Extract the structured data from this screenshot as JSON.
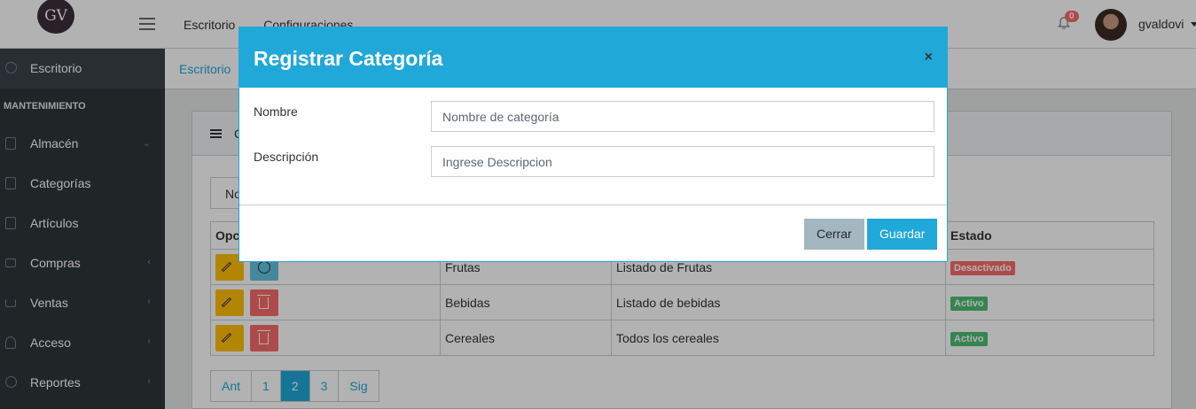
{
  "header": {
    "logo_text": "GV",
    "nav": [
      "Escritorio",
      "Configuraciones"
    ],
    "notification_count": "0",
    "username": "gvaldovi"
  },
  "sidebar": {
    "section_title": "MANTENIMIENTO",
    "items": [
      {
        "label": "Escritorio",
        "icon": "speedometer-icon",
        "chevron": false
      },
      {
        "label": "Almacén",
        "icon": "bag-icon",
        "chevron": true
      },
      {
        "label": "Categorías",
        "icon": "bag-icon",
        "chevron": false
      },
      {
        "label": "Artículos",
        "icon": "bag-icon",
        "chevron": false
      },
      {
        "label": "Compras",
        "icon": "wallet-icon",
        "chevron": true
      },
      {
        "label": "Ventas",
        "icon": "basket-icon",
        "chevron": true
      },
      {
        "label": "Acceso",
        "icon": "people-icon",
        "chevron": true
      },
      {
        "label": "Reportes",
        "icon": "pie-chart-icon",
        "chevron": true
      }
    ]
  },
  "breadcrumb": {
    "current": "Escritorio"
  },
  "card": {
    "header_text": "C",
    "search_stub": "No"
  },
  "table": {
    "headers": {
      "options": "Opc",
      "estado": "Estado"
    },
    "rows": [
      {
        "nombre": "Frutas",
        "descripcion": "Listado de Frutas",
        "estado": "Desactivado",
        "estado_color": "#f86c6b"
      },
      {
        "nombre": "Bebidas",
        "descripcion": "Listado de bebidas",
        "estado": "Activo",
        "estado_color": "#4dbd74"
      },
      {
        "nombre": "Cereales",
        "descripcion": "Todos los cereales",
        "estado": "Activo",
        "estado_color": "#4dbd74"
      }
    ]
  },
  "pagination": {
    "prev": "Ant",
    "pages": [
      "1",
      "2",
      "3"
    ],
    "active_page": "2",
    "next": "Sig"
  },
  "modal": {
    "title": "Registrar Categoría",
    "close": "×",
    "fields": {
      "nombre_label": "Nombre",
      "nombre_placeholder": "Nombre de categoría",
      "descripcion_label": "Descripción",
      "descripcion_placeholder": "Ingrese Descripcion"
    },
    "buttons": {
      "cancel": "Cerrar",
      "save": "Guardar"
    }
  },
  "colors": {
    "primary": "#20a8d8",
    "sidebar": "#2f353a",
    "danger": "#f86c6b",
    "success": "#4dbd74",
    "warning": "#ffc107"
  }
}
